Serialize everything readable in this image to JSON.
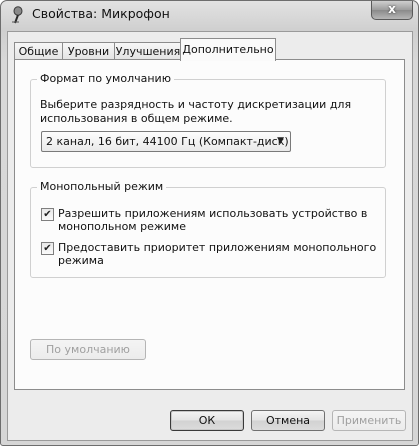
{
  "window": {
    "title": "Свойства: Микрофон",
    "close_glyph": "x",
    "icon": "microphone-icon"
  },
  "tabs": [
    {
      "label": "Общие",
      "active": false
    },
    {
      "label": "Уровни",
      "active": false
    },
    {
      "label": "Улучшения",
      "active": false
    },
    {
      "label": "Дополнительно",
      "active": true
    }
  ],
  "default_format": {
    "title": "Формат по умолчанию",
    "description": "Выберите разрядность и частоту дискретизации для использования в общем режиме.",
    "selected_value": "2 канал, 16 бит, 44100 Гц (Компакт-диск)"
  },
  "exclusive_mode": {
    "title": "Монопольный режим",
    "options": [
      {
        "label": "Разрешить приложениям использовать устройство в монопольном режиме",
        "checked": true
      },
      {
        "label": "Предоставить приоритет приложениям монопольного режима",
        "checked": true
      }
    ]
  },
  "buttons": {
    "restore_defaults": "По умолчанию",
    "ok": "ОК",
    "cancel": "Отмена",
    "apply": "Применить"
  }
}
